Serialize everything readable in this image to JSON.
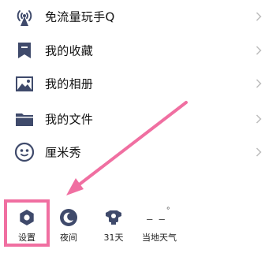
{
  "menu": {
    "items": [
      {
        "label": "免流量玩手Q",
        "icon": "wifi-tower-icon"
      },
      {
        "label": "我的收藏",
        "icon": "bookmark-icon"
      },
      {
        "label": "我的相册",
        "icon": "photo-album-icon"
      },
      {
        "label": "我的文件",
        "icon": "folder-icon"
      },
      {
        "label": "厘米秀",
        "icon": "avatar-face-icon"
      }
    ]
  },
  "bottom_bar": {
    "settings_label": "设置",
    "night_label": "夜间",
    "calendar_label": "31天",
    "weather_label": "当地天气",
    "weather_temp": "_ _",
    "weather_degree": "°"
  },
  "colors": {
    "icon": "#3f4a6b",
    "highlight": "#f06fa1",
    "text": "#111111",
    "chevron": "#bdbdbd"
  }
}
